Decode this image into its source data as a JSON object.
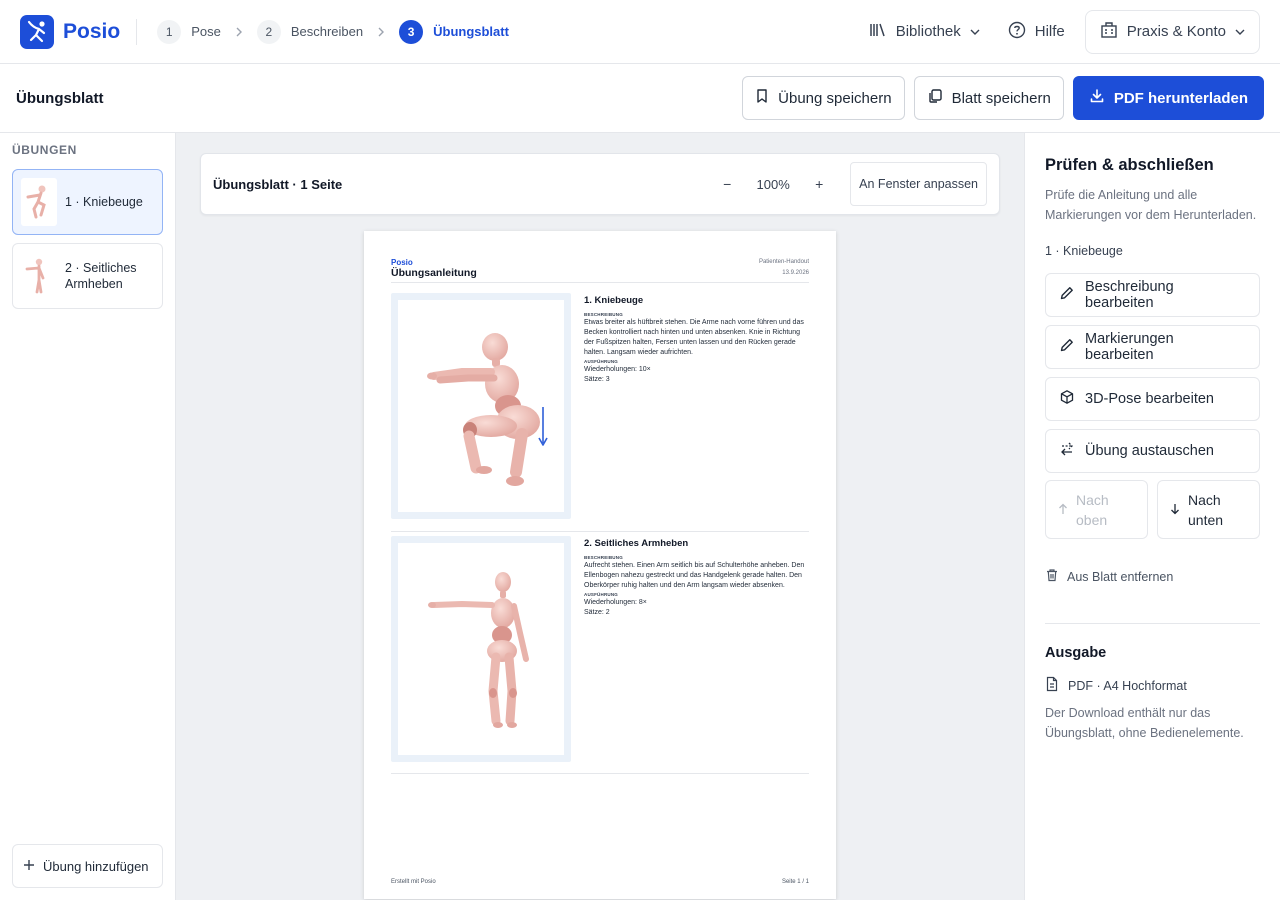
{
  "app": {
    "name": "Posio",
    "steps": [
      {
        "num": "1",
        "label": "Pose"
      },
      {
        "num": "2",
        "label": "Beschreiben"
      },
      {
        "num": "3",
        "label": "Übungsblatt"
      }
    ],
    "nav": {
      "library": "Bibliothek",
      "help": "Hilfe",
      "account": "Praxis & Konto"
    }
  },
  "header": {
    "title": "Übungsblatt",
    "save_exercise": "Übung speichern",
    "save_sheet": "Blatt speichern",
    "download_pdf": "PDF herunterladen"
  },
  "sidebar": {
    "heading": "ÜBUNGEN",
    "items": [
      {
        "label": "1 · Kniebeuge"
      },
      {
        "label": "2 · Seitliches Armheben"
      }
    ],
    "add_label": "Übung hinzufügen"
  },
  "viewer": {
    "title": "Übungsblatt · 1 Seite",
    "zoom_out": "−",
    "zoom": "100%",
    "zoom_in": "+",
    "fit": "An Fenster anpassen"
  },
  "sheet": {
    "brand": "Posio",
    "title": "Übungsanleitung",
    "handout": "Patienten-Handout",
    "date": "13.9.2026",
    "exercises": [
      {
        "heading": "1. Kniebeuge",
        "desc_label": "BESCHREIBUNG",
        "desc": "Etwas breiter als hüftbreit stehen. Die Arme nach vorne führen und das Becken kontrolliert nach hinten und unten absenken. Knie in Richtung der Fußspitzen halten, Fersen unten lassen und den Rücken gerade halten. Langsam wieder aufrichten.",
        "exec_label": "AUSFÜHRUNG",
        "reps": "Wiederholungen: 10×",
        "sets": "Sätze: 3"
      },
      {
        "heading": "2. Seitliches Armheben",
        "desc_label": "BESCHREIBUNG",
        "desc": "Aufrecht stehen. Einen Arm seitlich bis auf Schulterhöhe anheben. Den Ellenbogen nahezu gestreckt und das Handgelenk gerade halten. Den Oberkörper ruhig halten und den Arm langsam wieder absenken.",
        "exec_label": "AUSFÜHRUNG",
        "reps": "Wiederholungen: 8×",
        "sets": "Sätze: 2"
      }
    ],
    "footer_left": "Erstellt mit Posio",
    "footer_right": "Seite 1 / 1"
  },
  "panel": {
    "title": "Prüfen & abschließen",
    "desc": "Prüfe die Anleitung und alle Markierungen vor dem Herunterladen.",
    "selected": "1 · Kniebeuge",
    "edit_desc": "Beschreibung bearbeiten",
    "edit_marks": "Markierungen bearbeiten",
    "edit_pose": "3D-Pose bearbeiten",
    "swap": "Übung austauschen",
    "move_up": "Nach oben",
    "move_down": "Nach unten",
    "remove": "Aus Blatt entfernen",
    "output_title": "Ausgabe",
    "output_format": "PDF · A4 Hochformat",
    "output_note": "Der Download enthält nur das Übungsblatt, ohne Bedienelemente."
  },
  "colors": {
    "accent": "#1d4ed8",
    "figure": "#f0c4bd",
    "marker": "#2f5fd8"
  }
}
